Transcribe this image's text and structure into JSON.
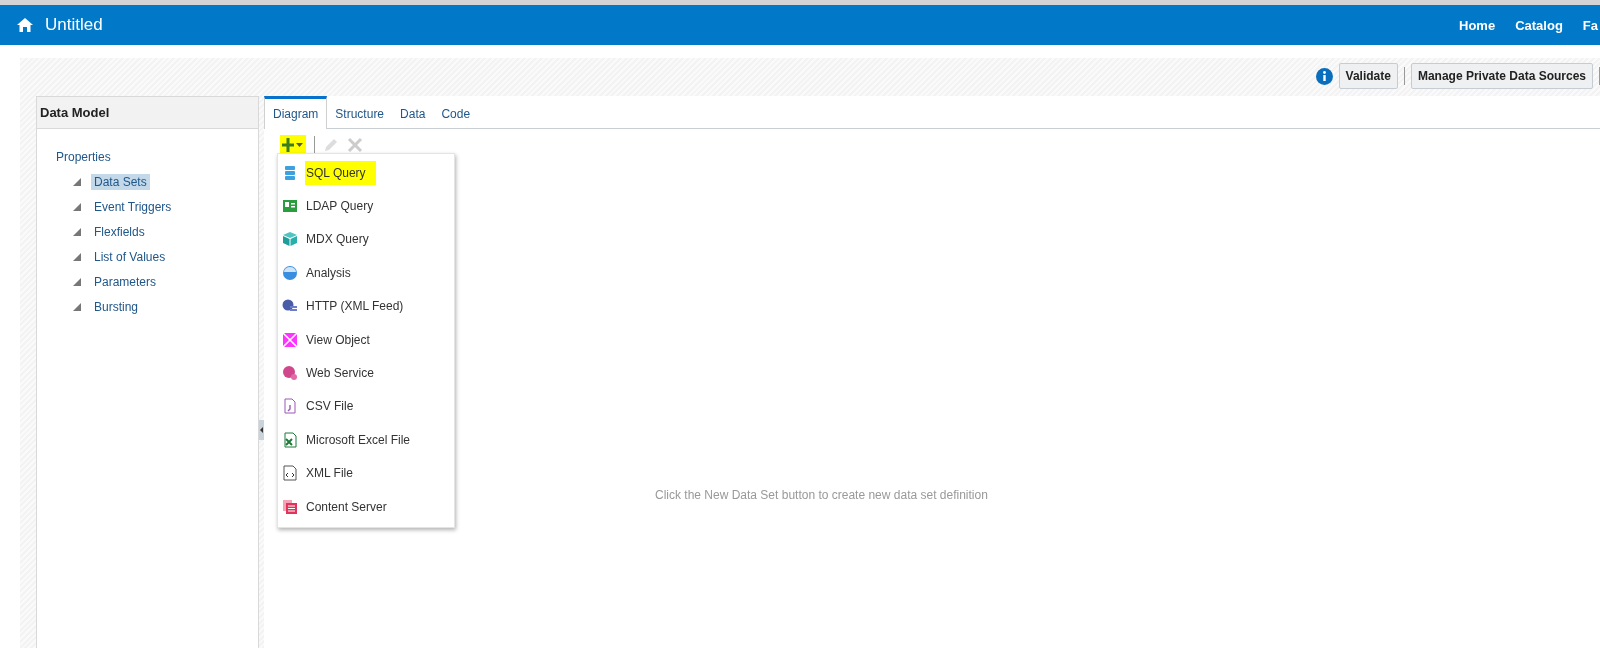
{
  "header": {
    "title": "Untitled",
    "nav": [
      "Home",
      "Catalog",
      "Fa"
    ]
  },
  "toolbar": {
    "buttons": [
      "Validate",
      "Manage Private Data Sources"
    ]
  },
  "sidebar": {
    "title": "Data Model",
    "tree": [
      {
        "label": "Properties",
        "selected": false,
        "children": [
          {
            "label": "Data Sets",
            "selected": true
          },
          {
            "label": "Event Triggers",
            "selected": false
          },
          {
            "label": "Flexfields",
            "selected": false
          },
          {
            "label": "List of Values",
            "selected": false
          },
          {
            "label": "Parameters",
            "selected": false
          },
          {
            "label": "Bursting",
            "selected": false
          }
        ]
      }
    ]
  },
  "tabs": [
    {
      "label": "Diagram",
      "selected": true
    },
    {
      "label": "Structure",
      "selected": false
    },
    {
      "label": "Data",
      "selected": false
    },
    {
      "label": "Code",
      "selected": false
    }
  ],
  "new_menu": {
    "highlighted": true,
    "items": [
      {
        "label": "SQL Query",
        "kind": "sql",
        "highlighted": true
      },
      {
        "label": "LDAP Query",
        "kind": "ldap",
        "highlighted": false
      },
      {
        "label": "MDX Query",
        "kind": "mdx",
        "highlighted": false
      },
      {
        "label": "Analysis",
        "kind": "analysis",
        "highlighted": false
      },
      {
        "label": "HTTP (XML Feed)",
        "kind": "http",
        "highlighted": false
      },
      {
        "label": "View Object",
        "kind": "view",
        "highlighted": false
      },
      {
        "label": "Web Service",
        "kind": "web",
        "highlighted": false
      },
      {
        "label": "CSV File",
        "kind": "csv",
        "highlighted": false
      },
      {
        "label": "Microsoft Excel File",
        "kind": "excel",
        "highlighted": false
      },
      {
        "label": "XML File",
        "kind": "xml",
        "highlighted": false
      },
      {
        "label": "Content Server",
        "kind": "content",
        "highlighted": false
      }
    ]
  },
  "hint": "Click the New Data Set button to create new data set definition"
}
